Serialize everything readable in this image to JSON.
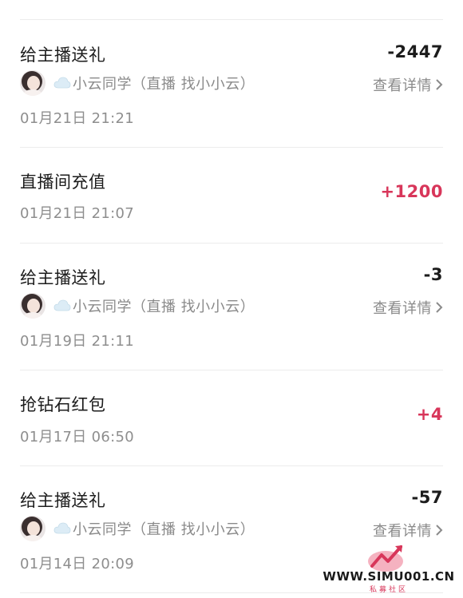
{
  "detail_label": "查看详情",
  "anchor_name": "小云同学（直播 找小小云）",
  "transactions": [
    {
      "title": "给主播送礼",
      "amount": "-2447",
      "type": "negative",
      "time": "01月21日 21:21",
      "has_anchor": true
    },
    {
      "title": "直播间充值",
      "amount": "+1200",
      "type": "positive",
      "time": "01月21日 21:07",
      "has_anchor": false
    },
    {
      "title": "给主播送礼",
      "amount": "-3",
      "type": "negative",
      "time": "01月19日 21:11",
      "has_anchor": true
    },
    {
      "title": "抢钻石红包",
      "amount": "+4",
      "type": "positive",
      "time": "01月17日 06:50",
      "has_anchor": false
    },
    {
      "title": "给主播送礼",
      "amount": "-57",
      "type": "negative",
      "time": "01月14日 20:09",
      "has_anchor": true
    }
  ],
  "colors": {
    "positive": "#d8365a",
    "negative": "#1c1c1c",
    "secondary": "#8a8a8a"
  },
  "watermark": {
    "url": "WWW.SIMU001.CN",
    "caption": "私募社区"
  }
}
